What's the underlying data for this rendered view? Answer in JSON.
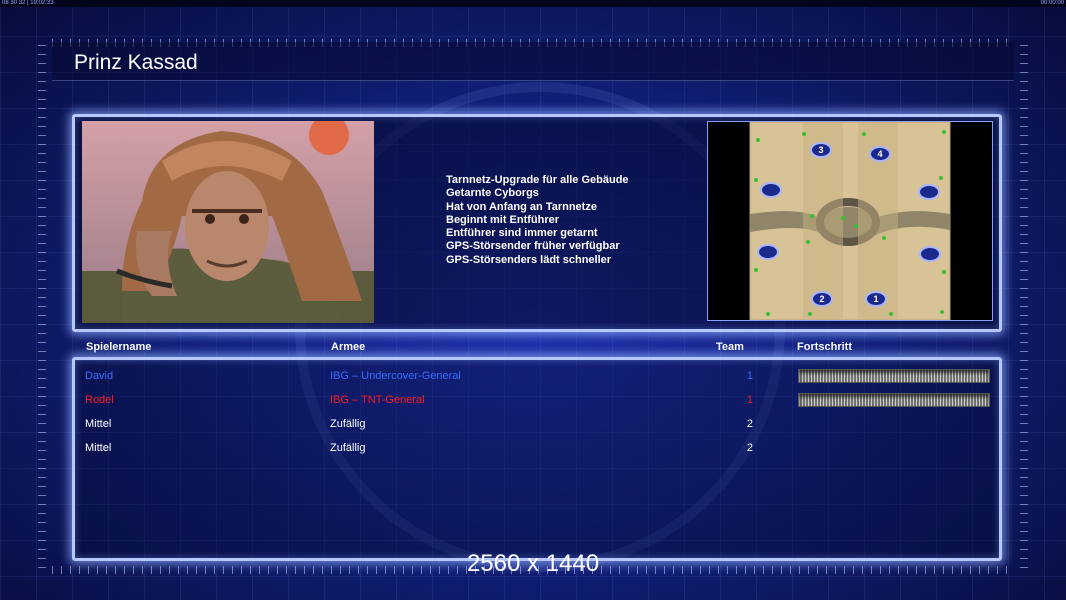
{
  "hud": {
    "left_text": "08 30 32 | 19:02:33",
    "right_text": "00:00:00"
  },
  "title": "Prinz Kassad",
  "features": [
    "Tarnnetz-Upgrade für alle Gebäude",
    "Getarnte Cyborgs",
    "Hat von Anfang an Tarnnetze",
    "Beginnt mit Entführer",
    "Entführer sind immer getarnt",
    "GPS-Störsender früher verfügbar",
    "GPS-Störsenders lädt schneller"
  ],
  "minimap": {
    "start_positions": [
      "3",
      "4",
      "2",
      "1"
    ]
  },
  "columns": {
    "player": "Spielername",
    "army": "Armee",
    "team": "Team",
    "progress": "Fortschritt"
  },
  "players": [
    {
      "name": "David",
      "army": "IBG – Undercover-General",
      "team": "1",
      "color": "#3a6bff",
      "progress": 1.0
    },
    {
      "name": "Rodel",
      "army": "IBG – TNT-General",
      "team": "1",
      "color": "#ff1a1a",
      "progress": 1.0
    },
    {
      "name": "Mittel",
      "army": "Zufällig",
      "team": "2",
      "color": "#ffffff",
      "progress": null
    },
    {
      "name": "Mittel",
      "army": "Zufällig",
      "team": "2",
      "color": "#ffffff",
      "progress": null
    }
  ],
  "resolution_label": "2560 x 1440",
  "colors": {
    "panel_border": "#b7c8ff",
    "background": "#11207a"
  }
}
